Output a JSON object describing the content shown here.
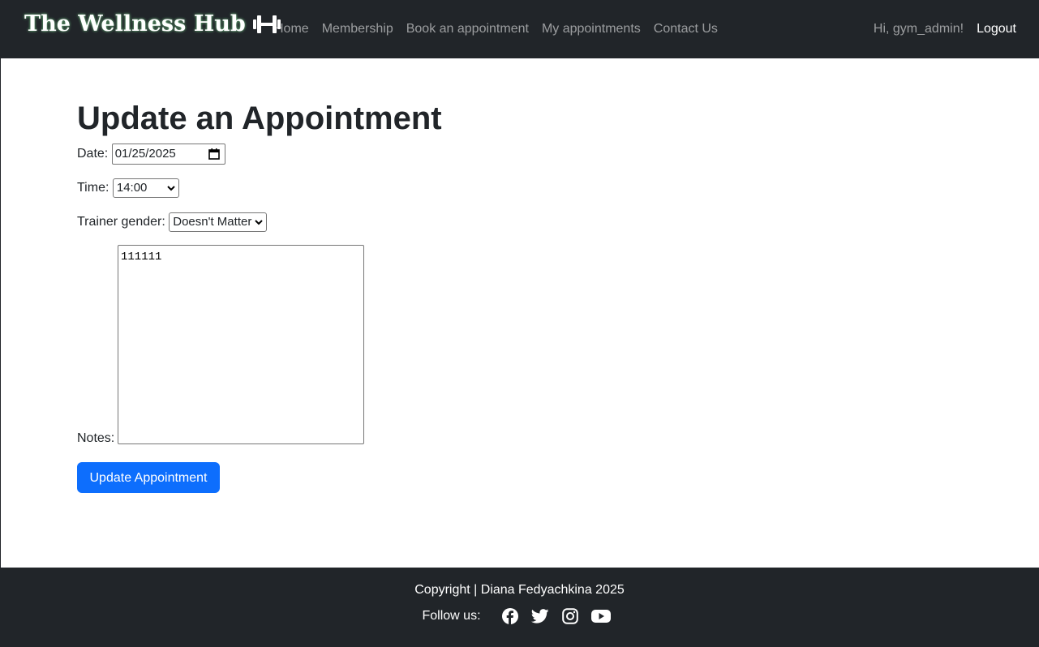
{
  "navbar": {
    "brand": "The Wellness Hub",
    "links": [
      "Home",
      "Membership",
      "Book an appointment",
      "My appointments",
      "Contact Us"
    ],
    "greeting": "Hi, gym_admin!",
    "logout": "Logout"
  },
  "form": {
    "title": "Update an Appointment",
    "date_label": "Date:",
    "date_value": "01/25/2025",
    "time_label": "Time:",
    "time_value": "14:00",
    "trainer_label": "Trainer gender:",
    "trainer_value": "Doesn't Matter",
    "notes_label": "Notes:",
    "notes_value": "111111",
    "submit": "Update Appointment"
  },
  "footer": {
    "copyright": "Copyright | Diana Fedyachkina 2025",
    "follow": "Follow us:",
    "social_icons": [
      "facebook-icon",
      "twitter-icon",
      "instagram-icon",
      "youtube-icon"
    ]
  },
  "colors": {
    "navbar_bg": "#212529",
    "primary": "#0d6efd",
    "brand_glow": "#7bd88f"
  }
}
